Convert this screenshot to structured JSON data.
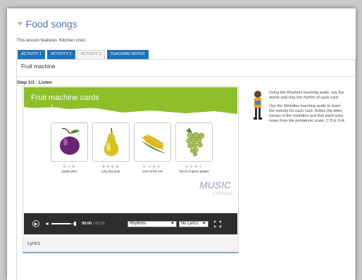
{
  "page": {
    "title": "Food songs",
    "intro": "This lesson features 'Kitchen cries'."
  },
  "tabs": [
    {
      "label": "ACTIVITY 1",
      "active": true
    },
    {
      "label": "ACTIVITY 2",
      "active": true
    },
    {
      "label": "ACTIVITY 3",
      "active": false
    },
    {
      "label": "TEACHING NOTES",
      "active": true
    }
  ],
  "section": {
    "title": "Fruit machine",
    "step": "Step 1/3 - Listen"
  },
  "player": {
    "banner_title": "Fruit machine cards",
    "cards": [
      {
        "notes": "G A G",
        "caption": "purple plum",
        "icon": "plum-icon"
      },
      {
        "notes": "E E G E",
        "caption": "juicy ripe pear",
        "icon": "pear-icon"
      },
      {
        "notes": "C' A G C'",
        "caption": "corn on the cob",
        "icon": "corn-icon"
      },
      {
        "notes": "C C G C",
        "caption": "bunch of green grapes",
        "icon": "grapes-icon"
      }
    ],
    "logo_main": "MUSIC",
    "logo_sub": "EXPRESS",
    "time_current": "00:00",
    "time_total": "/ 00:25",
    "volume": 0.8,
    "rhythm_select": "Rhythms",
    "lyrics_select": "No Lyrics"
  },
  "lyrics": {
    "label": "Lyrics"
  },
  "instructions": {
    "p1": "Using the Rhythms teaching audio, say the words and clap the rhythm of each card.",
    "p2": "Use the Melodies teaching audio to learn the melody for each card. Notice the letter names of the melodies and that each uses notes from the pentatonic scale: C D E G A."
  },
  "colors": {
    "accent": "#1f73b7",
    "banner": "#8cbf28",
    "title": "#4a74a8"
  }
}
